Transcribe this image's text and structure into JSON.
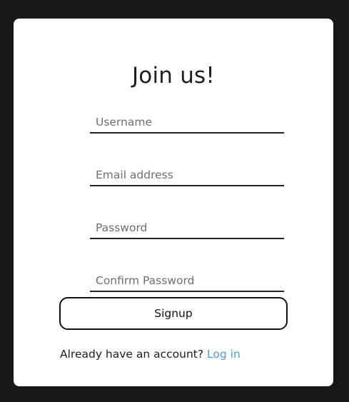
{
  "form": {
    "title": "Join us!",
    "fields": [
      {
        "placeholder": "Username",
        "value": ""
      },
      {
        "placeholder": "Email address",
        "value": ""
      },
      {
        "placeholder": "Password",
        "value": ""
      },
      {
        "placeholder": "Confirm Password",
        "value": ""
      }
    ],
    "submit_label": "Signup",
    "footer_text": "Already have an account?",
    "login_link": "Log in"
  },
  "colors": {
    "page_background": "#171717",
    "card_background": "#ffffff",
    "link": "#4a9be8"
  }
}
